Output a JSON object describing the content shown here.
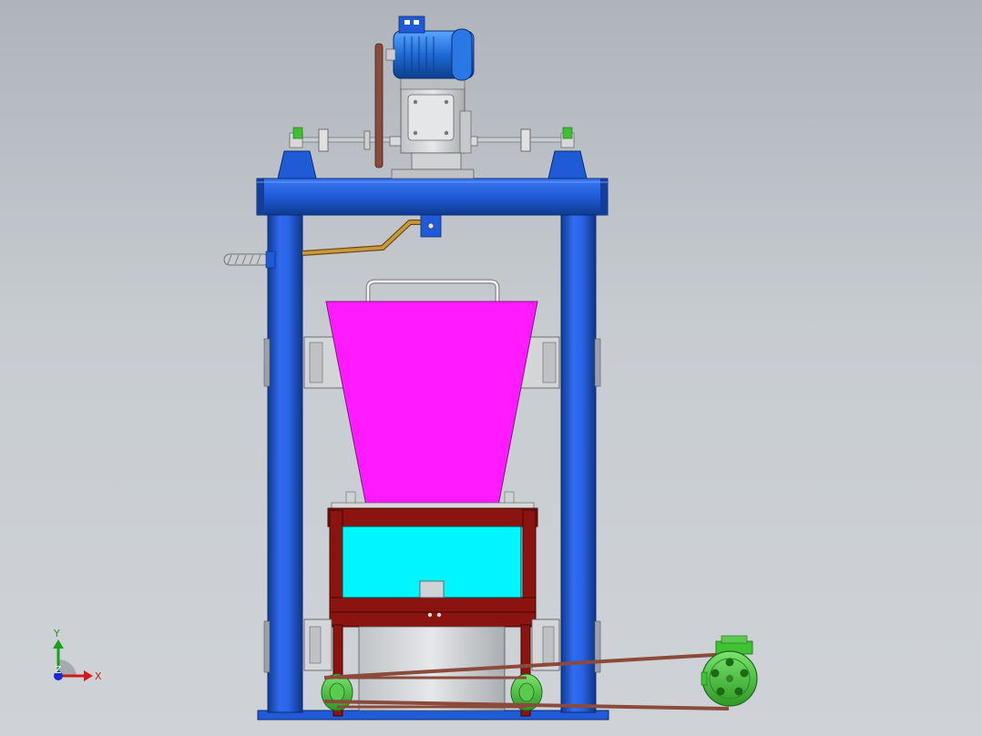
{
  "view": {
    "axis_labels": {
      "x": "X",
      "y": "Y",
      "z": "Z"
    }
  },
  "colors": {
    "frame": "#1f5bd6",
    "frame_dark": "#123f9e",
    "hopper": "#ff1aff",
    "bin": "#00f5ff",
    "bin_frame": "#8b1410",
    "belt": "#8a4a3c",
    "rod": "#b37d2a",
    "motor": "#2d7ee0",
    "green_part": "#3fc234",
    "metal": "#d4d4d4"
  }
}
